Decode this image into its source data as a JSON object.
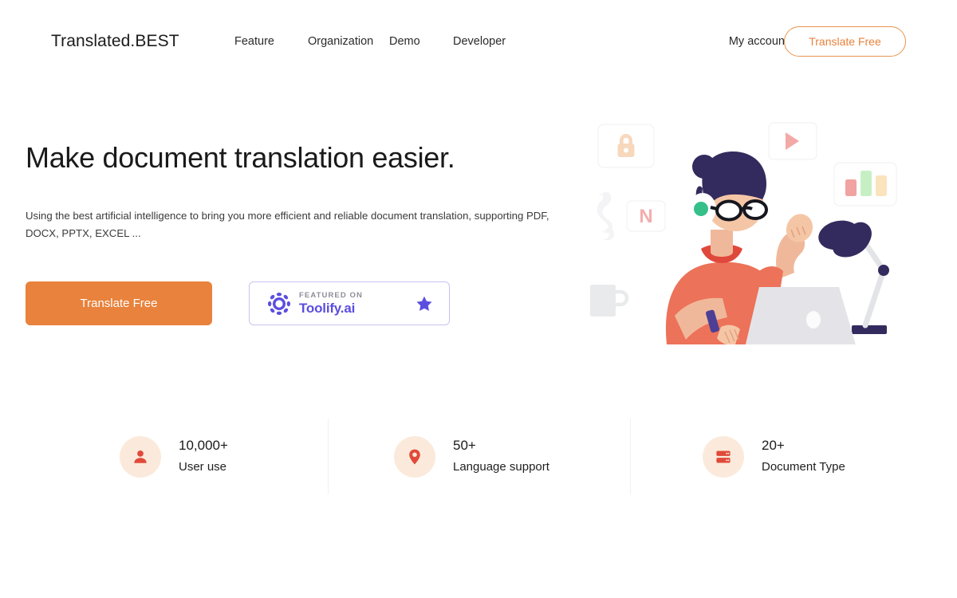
{
  "header": {
    "logo": "Translated.BEST",
    "nav": [
      {
        "label": "Feature",
        "name": "nav-item-feature"
      },
      {
        "label": "Organization",
        "name": "nav-item-organization"
      },
      {
        "label": "Demo",
        "name": "nav-item-demo"
      },
      {
        "label": "Developer",
        "name": "nav-item-developer"
      }
    ],
    "account_label": "My account",
    "cta_label": "Translate Free"
  },
  "hero": {
    "title": "Make document translation easier.",
    "description": "Using the best artificial intelligence to bring you more efficient and reliable document translation, supporting PDF, DOCX, PPTX, EXCEL ...",
    "cta_label": "Translate Free",
    "badge": {
      "featured_text": "FEATURED ON",
      "brand": "Toolify.ai",
      "logo_icon": "toolify-gear-icon",
      "star_icon": "star-icon"
    }
  },
  "illustration": {
    "name": "person-at-laptop-illustration",
    "cards": [
      {
        "name": "lock-card",
        "icon": "lock-icon"
      },
      {
        "name": "play-card",
        "icon": "play-icon"
      },
      {
        "name": "chart-card",
        "icon": "bar-chart-icon"
      },
      {
        "name": "letter-card",
        "letter": "N"
      }
    ],
    "props": [
      {
        "name": "coffee-mug"
      },
      {
        "name": "steam"
      },
      {
        "name": "desk-lamp"
      },
      {
        "name": "laptop"
      }
    ]
  },
  "stats": [
    {
      "value": "10,000+",
      "label": "User use",
      "icon": "user-icon",
      "name": "stat-user-use"
    },
    {
      "value": "50+",
      "label": "Language support",
      "icon": "location-pin-icon",
      "name": "stat-language-support"
    },
    {
      "value": "20+",
      "label": "Document Type",
      "icon": "server-stack-icon",
      "name": "stat-document-type"
    }
  ],
  "colors": {
    "accent_orange": "#e8823c",
    "accent_red": "#e04a3a",
    "icon_bg_peach": "#fbeadb",
    "toolify_purple": "#5b4ee0",
    "illustration_navy": "#332b5e",
    "illustration_coral": "#ec7259"
  }
}
